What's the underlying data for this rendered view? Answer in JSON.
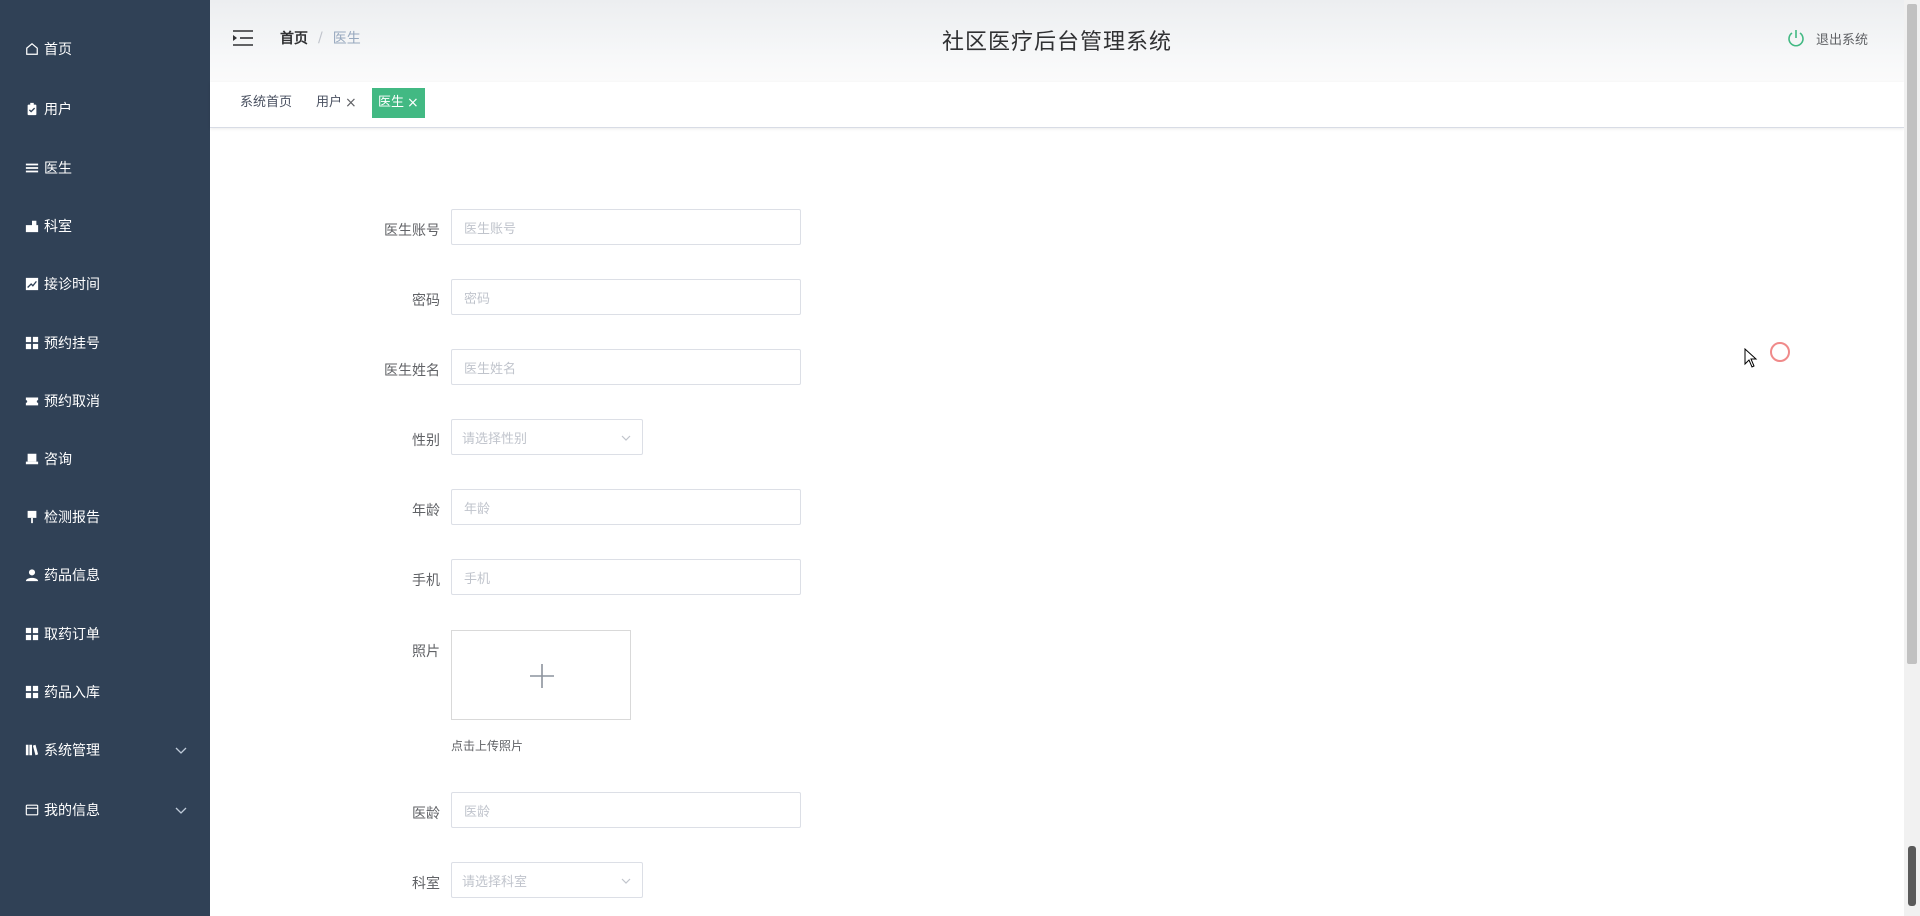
{
  "sidebar": {
    "items": [
      {
        "label": "首页",
        "icon": "home-icon"
      },
      {
        "label": "用户",
        "icon": "clipboard-icon"
      },
      {
        "label": "医生",
        "icon": "list-icon"
      },
      {
        "label": "科室",
        "icon": "building-icon"
      },
      {
        "label": "接诊时间",
        "icon": "chart-icon"
      },
      {
        "label": "预约挂号",
        "icon": "grid-icon"
      },
      {
        "label": "预约取消",
        "icon": "ticket-icon"
      },
      {
        "label": "咨询",
        "icon": "printer-icon"
      },
      {
        "label": "检测报告",
        "icon": "pin-icon"
      },
      {
        "label": "药品信息",
        "icon": "user-icon"
      },
      {
        "label": "取药订单",
        "icon": "grid-icon"
      },
      {
        "label": "药品入库",
        "icon": "grid-icon"
      },
      {
        "label": "系统管理",
        "icon": "bars-icon"
      },
      {
        "label": "我的信息",
        "icon": "wallet-icon"
      }
    ]
  },
  "header": {
    "title": "社区医疗后台管理系统",
    "breadcrumb": {
      "home": "首页",
      "separator": "/",
      "current": "医生"
    },
    "logout_label": "退出系统"
  },
  "tags": [
    {
      "label": "系统首页",
      "closable": false
    },
    {
      "label": "用户",
      "closable": true
    },
    {
      "label": "医生",
      "closable": true,
      "active": true
    }
  ],
  "tag_close_glyph": "×",
  "form": {
    "doctor_account": {
      "label": "医生账号",
      "placeholder": "医生账号"
    },
    "password": {
      "label": "密码",
      "placeholder": "密码"
    },
    "doctor_name": {
      "label": "医生姓名",
      "placeholder": "医生姓名"
    },
    "gender": {
      "label": "性别",
      "placeholder": "请选择性别"
    },
    "age": {
      "label": "年龄",
      "placeholder": "年龄"
    },
    "phone": {
      "label": "手机",
      "placeholder": "手机"
    },
    "photo": {
      "label": "照片",
      "upload_tip": "点击上传照片"
    },
    "years": {
      "label": "医龄",
      "placeholder": "医龄"
    },
    "department": {
      "label": "科室",
      "placeholder": "请选择科室"
    }
  },
  "colors": {
    "sidebar_bg": "#304156",
    "active_tag": "#42b983",
    "logout_icon": "#42b983"
  }
}
